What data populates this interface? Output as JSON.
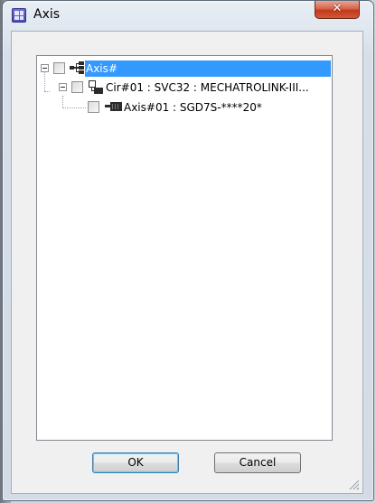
{
  "window": {
    "title": "Axis"
  },
  "tree": {
    "root": {
      "label": "Axis#",
      "selected": true,
      "checked": false
    },
    "circuit": {
      "label": "Cir#01 : SVC32 : MECHATROLINK-III...",
      "checked": false
    },
    "axis": {
      "label": "Axis#01 : SGD7S-****20*",
      "checked": false
    }
  },
  "buttons": {
    "ok": "OK",
    "cancel": "Cancel"
  },
  "colors": {
    "selection": "#3399ff",
    "close": "#c2391a"
  }
}
